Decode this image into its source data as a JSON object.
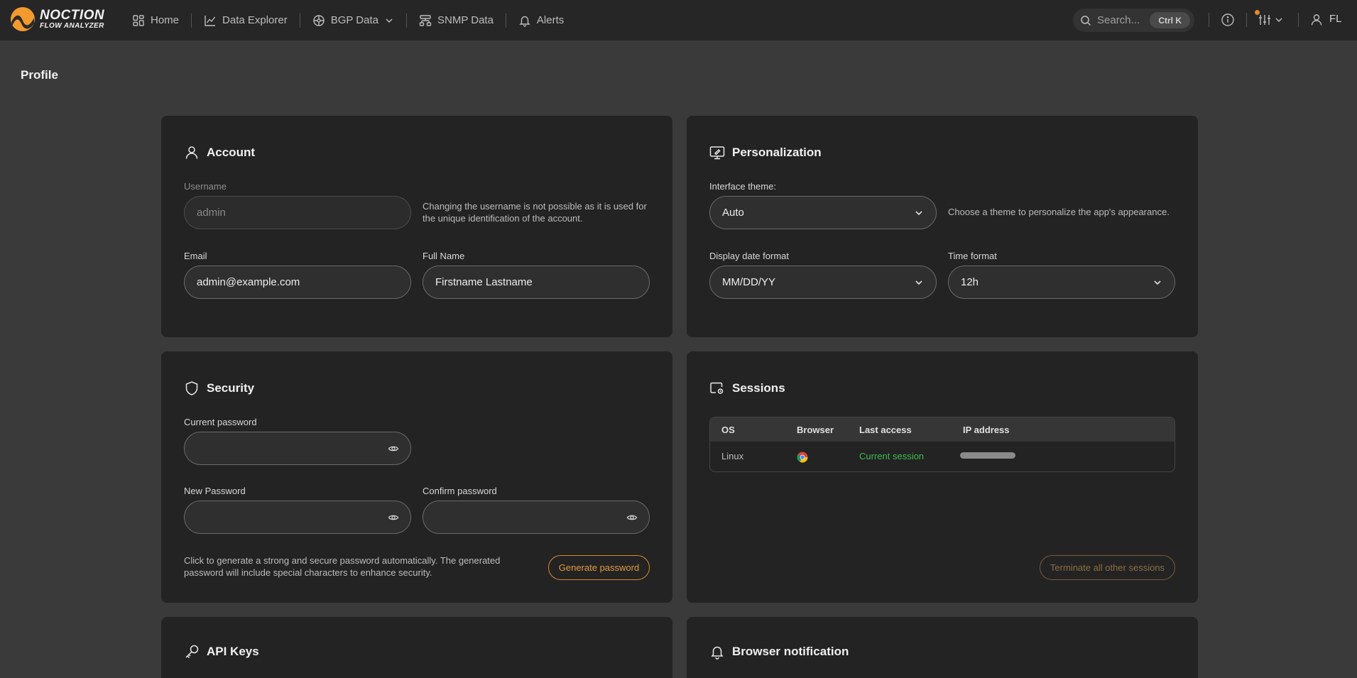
{
  "brand": {
    "line1": "NOCTION",
    "line2": "FLOW ANALYZER"
  },
  "nav": {
    "home": "Home",
    "data_explorer": "Data Explorer",
    "bgp_data": "BGP Data",
    "snmp_data": "SNMP Data",
    "alerts": "Alerts"
  },
  "topbar": {
    "search_placeholder": "Search...",
    "search_shortcut": "Ctrl K",
    "user_initials": "FL"
  },
  "page": {
    "title": "Profile"
  },
  "account": {
    "title": "Account",
    "username_label": "Username",
    "username_value": "admin",
    "username_help": "Changing the username is not possible as it is used for the unique identification of the account.",
    "email_label": "Email",
    "email_value": "admin@example.com",
    "fullname_label": "Full Name",
    "fullname_value": "Firstname Lastname"
  },
  "personalization": {
    "title": "Personalization",
    "theme_label": "Interface theme:",
    "theme_value": "Auto",
    "theme_help": "Choose a theme to personalize the app's appearance.",
    "date_label": "Display date format",
    "date_value": "MM/DD/YY",
    "time_label": "Time format",
    "time_value": "12h"
  },
  "security": {
    "title": "Security",
    "current_label": "Current password",
    "new_label": "New Password",
    "confirm_label": "Confirm password",
    "generate_help": "Click to generate a strong and secure password automatically. The generated password will include special characters to enhance security.",
    "generate_button": "Generate password"
  },
  "sessions": {
    "title": "Sessions",
    "columns": [
      "OS",
      "Browser",
      "Last access",
      "IP address"
    ],
    "rows": [
      {
        "os": "Linux",
        "browser_icon": "chrome-icon",
        "last_access": "Current session",
        "ip": ""
      }
    ],
    "terminate_button": "Terminate all other sessions"
  },
  "api_keys": {
    "title": "API Keys"
  },
  "browser_notification": {
    "title": "Browser notification"
  },
  "colors": {
    "accent": "#e39a3d",
    "success": "#3fb950",
    "notification_dot": "#e08a2e"
  }
}
